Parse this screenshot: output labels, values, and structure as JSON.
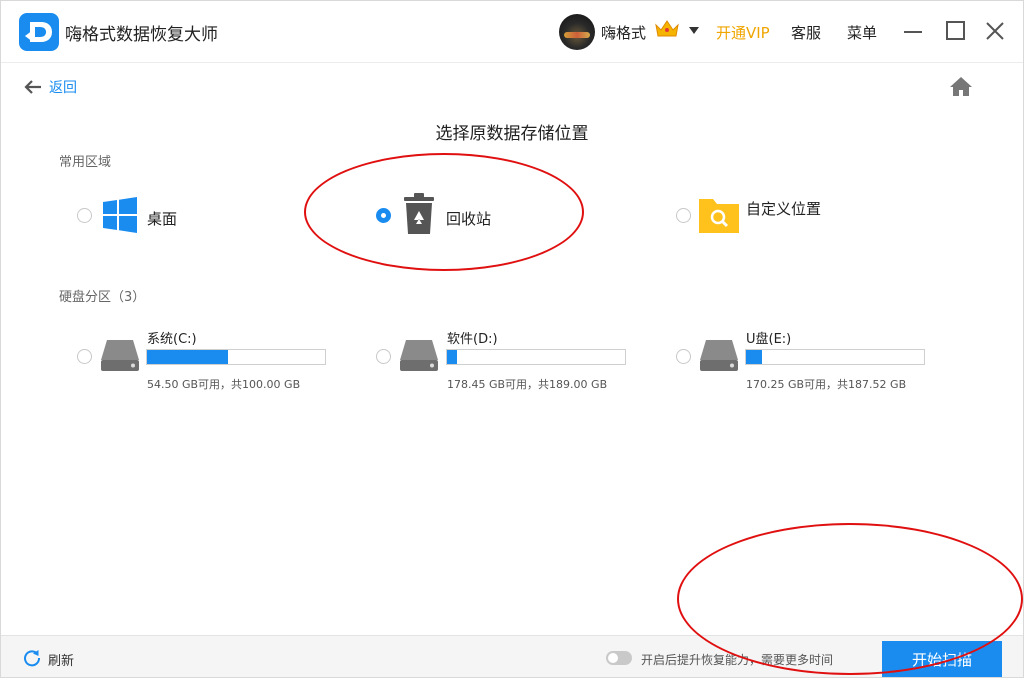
{
  "titlebar": {
    "app_title": "嗨格式数据恢复大师",
    "user_name": "嗨格式",
    "vip_label": "开通VIP",
    "service_label": "客服",
    "menu_label": "菜单"
  },
  "nav": {
    "back_label": "返回"
  },
  "page_title": "选择原数据存储位置",
  "common_section": {
    "label": "常用区域",
    "options": [
      {
        "label": "桌面",
        "icon": "windows-icon",
        "checked": false
      },
      {
        "label": "回收站",
        "icon": "recycle-bin-icon",
        "checked": true
      },
      {
        "label": "自定义位置",
        "icon": "folder-search-icon",
        "checked": false
      }
    ]
  },
  "disk_section": {
    "label": "硬盘分区（3）",
    "drives": [
      {
        "name": "系统(C:)",
        "info": "54.50 GB可用，共100.00 GB",
        "used_fraction": 0.455,
        "checked": false
      },
      {
        "name": "软件(D:)",
        "info": "178.45 GB可用，共189.00 GB",
        "used_fraction": 0.056,
        "checked": false
      },
      {
        "name": "U盘(E:)",
        "info": "170.25 GB可用，共187.52 GB",
        "used_fraction": 0.092,
        "checked": false
      }
    ]
  },
  "bottombar": {
    "refresh_label": "刷新",
    "toggle_label": "开启后提升恢复能力，需要更多时间",
    "scan_label": "开始扫描"
  },
  "colors": {
    "accent": "#1a8cf0",
    "vip": "#f0a500",
    "annotation": "#e01010"
  }
}
